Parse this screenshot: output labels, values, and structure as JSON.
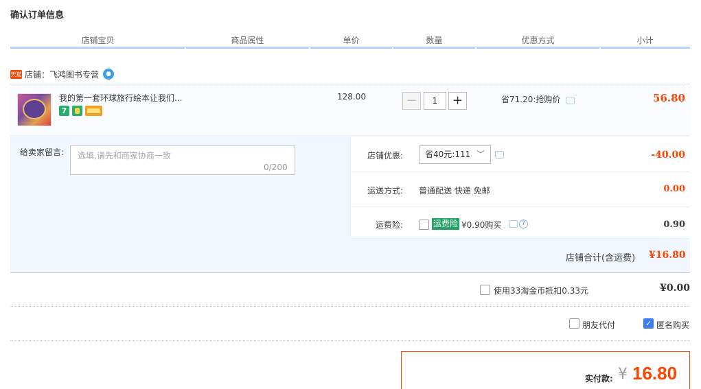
{
  "page_title": "确认订单信息",
  "headers": [
    "店铺宝贝",
    "商品属性",
    "单价",
    "数量",
    "优惠方式",
    "小计"
  ],
  "shop": {
    "badge": "天猫",
    "name": "店铺：飞鸿图书专营",
    "ww_icon": "wangwang-icon"
  },
  "item": {
    "title": "我的第一套环球旅行绘本让我们...",
    "unit_price": "128.00",
    "quantity": "1",
    "minus": "−",
    "plus": "+",
    "promotion": "省71.20:抢购价",
    "subtotal": "56.80",
    "service_icons": [
      "seven-day-return-icon",
      "guarantee-icon",
      "credit-card-icon"
    ],
    "service_badge_text": "7"
  },
  "message": {
    "label": "给卖家留言:",
    "placeholder": "选填,请先和商家协商一致",
    "count": "0/200"
  },
  "shop_discount": {
    "label": "店铺优惠:",
    "selected": "省40元:111",
    "value": "-40.00"
  },
  "shipping": {
    "label": "运送方式:",
    "value_text": "普通配送 快递 免邮",
    "value": "0.00"
  },
  "insurance": {
    "label": "运费险:",
    "tag": "运费险",
    "text": "¥0.90购买",
    "value": "0.90"
  },
  "shop_total": {
    "label": "店铺合计(含运费)",
    "value": "¥16.80"
  },
  "coins": {
    "label": "使用33淘金币抵扣0.33元",
    "value": "¥0.00"
  },
  "options": {
    "friend_pay": "朋友代付",
    "anonymous": "匿名购买",
    "anonymous_checked": true
  },
  "payment": {
    "label": "实付款:",
    "currency": "¥",
    "amount": "16.80"
  },
  "colors": {
    "accent": "#ff4400",
    "header_line": "#b2d1ff",
    "panel_bg": "#f2f7ff",
    "checkbox_on": "#3d7bf0",
    "insurance_tag": "#21a366"
  }
}
